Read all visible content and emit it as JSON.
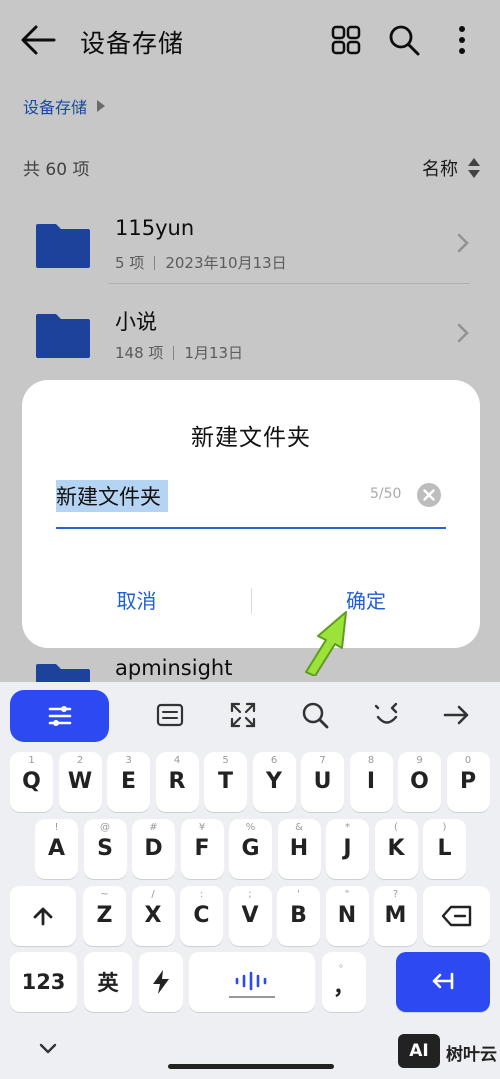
{
  "appbar": {
    "title": "设备存储"
  },
  "breadcrumb": {
    "label": "设备存储"
  },
  "list_header": {
    "count_label": "共 60 项",
    "sort_label": "名称"
  },
  "files": [
    {
      "name": "115yun",
      "count": "5 项",
      "date": "2023年10月13日"
    },
    {
      "name": "小说",
      "count": "148 项",
      "date": "1月13日"
    },
    {
      "name": "apminsight"
    }
  ],
  "dialog": {
    "title": "新建文件夹",
    "input_value": "新建文件夹",
    "char_count": "5/50",
    "cancel_label": "取消",
    "confirm_label": "确定"
  },
  "keyboard": {
    "row1": [
      {
        "main": "Q",
        "sub": "1"
      },
      {
        "main": "W",
        "sub": "2"
      },
      {
        "main": "E",
        "sub": "3"
      },
      {
        "main": "R",
        "sub": "4"
      },
      {
        "main": "T",
        "sub": "5"
      },
      {
        "main": "Y",
        "sub": "6"
      },
      {
        "main": "U",
        "sub": "7"
      },
      {
        "main": "I",
        "sub": "8"
      },
      {
        "main": "O",
        "sub": "9"
      },
      {
        "main": "P",
        "sub": "0"
      }
    ],
    "row2": [
      {
        "main": "A",
        "sub": "!"
      },
      {
        "main": "S",
        "sub": "@"
      },
      {
        "main": "D",
        "sub": "#"
      },
      {
        "main": "F",
        "sub": "¥"
      },
      {
        "main": "G",
        "sub": "%"
      },
      {
        "main": "H",
        "sub": "&"
      },
      {
        "main": "J",
        "sub": "*"
      },
      {
        "main": "K",
        "sub": "("
      },
      {
        "main": "L",
        "sub": ")"
      }
    ],
    "row3": [
      {
        "main": "Z",
        "sub": "~"
      },
      {
        "main": "X",
        "sub": "/"
      },
      {
        "main": "C",
        "sub": ":"
      },
      {
        "main": "V",
        "sub": ";"
      },
      {
        "main": "B",
        "sub": "'"
      },
      {
        "main": "N",
        "sub": "\""
      },
      {
        "main": "M",
        "sub": "?"
      }
    ],
    "numbers_label": "123",
    "lang_label": "英",
    "punct_label": "，",
    "punct_sub": "。"
  },
  "watermark": {
    "box": "AI",
    "text": "树叶云"
  },
  "colors": {
    "accent": "#1f5fd1",
    "folder": "#2555c8",
    "key_blue": "#2c49f2",
    "arrow": "#9be23a"
  }
}
